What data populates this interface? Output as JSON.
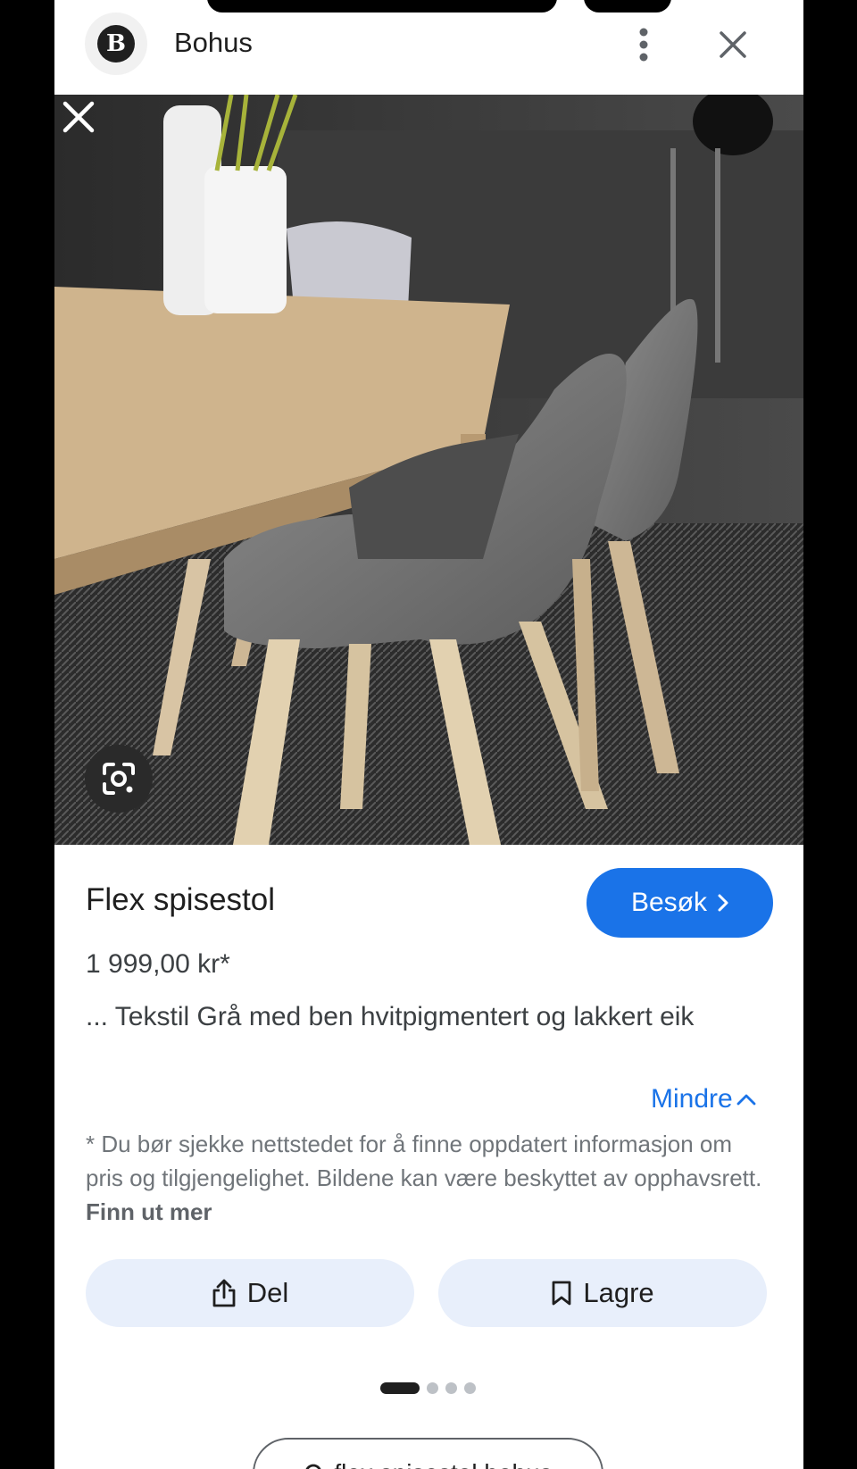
{
  "header": {
    "site_logo_letter": "B",
    "site_name": "Bohus",
    "more_icon": "more-vert-icon",
    "close_icon": "close-icon"
  },
  "image": {
    "close_icon": "close-icon",
    "lens_icon": "google-lens-icon"
  },
  "product": {
    "title": "Flex spisestol",
    "visit_label": "Besøk",
    "price": "1 999,00 kr*",
    "description": "... Tekstil Grå med ben hvitpigmentert og lakkert eik",
    "less_label": "Mindre",
    "disclaimer": "* Du bør sjekke nettstedet for å finne oppdatert informasjon om pris og tilgjengelighet. Bildene kan være beskyttet av opphavsrett.",
    "learn_more": "Finn ut mer"
  },
  "actions": {
    "share_label": "Del",
    "save_label": "Lagre"
  },
  "pager": {
    "total": 4,
    "current": 1
  },
  "related_search": {
    "label": "flex spisestol bohus"
  },
  "colors": {
    "accent": "#1a73e8",
    "chip_bg": "#e8effb"
  }
}
